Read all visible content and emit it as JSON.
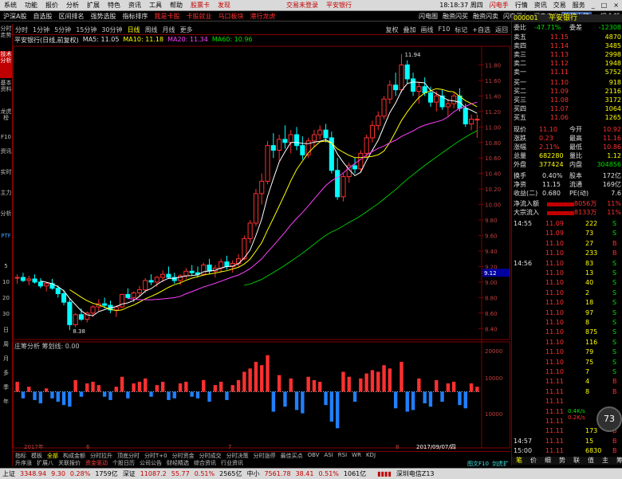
{
  "menubar": {
    "items": [
      "系统",
      "功能",
      "报价",
      "分析",
      "扩展",
      "特色",
      "资讯",
      "工具",
      "帮助"
    ],
    "red_items": [
      "股票卡",
      "发现"
    ],
    "center": [
      "交易未登录",
      "平安银行"
    ],
    "time": "18:18:37 周四",
    "tools": [
      "闪电手",
      "行情",
      "资讯",
      "交易",
      "服务"
    ]
  },
  "navbar": {
    "items": [
      "沪深A股",
      "自选股",
      "区间排名",
      "强势选股",
      "指标排序"
    ],
    "red_items": [
      "我是卡股",
      "卡股就业",
      "乌口板块",
      "港行龙虎"
    ],
    "right": [
      "闪电图",
      "融资闪买",
      "融资闪卖",
      "闪电买入",
      "闪电卖出"
    ],
    "selected": "拖拽上移",
    "extra": "一键全部"
  },
  "chart_toolbar": {
    "periods": [
      "分时",
      "1分钟",
      "5分钟",
      "15分钟",
      "30分钟",
      "日线",
      "周线",
      "月线",
      "更多"
    ],
    "selected": "日线",
    "right": [
      "复权",
      "叠加",
      "画线",
      "F10",
      "标记",
      "+自选",
      "返回"
    ]
  },
  "chart_info": {
    "title": "平安银行(日线,前复权)",
    "ma5": "MA5: 11.05",
    "ma10": "MA10: 11.18",
    "ma20": "MA20: 11.34",
    "ma60": "MA60: 10.96"
  },
  "vol_info": {
    "label": "庄筹分析",
    "sub": "筹划线: 0.00"
  },
  "left_tabs": [
    "分时走势",
    "技术分析",
    "基本资料",
    "龙虎榜",
    "F10",
    "资讯",
    "实时",
    "主力",
    "分析",
    "PTF",
    "5",
    "10",
    "20",
    "30",
    "日",
    "周",
    "月",
    "多",
    "季",
    "年"
  ],
  "price_axis": [
    "11.80",
    "11.60",
    "11.40",
    "11.20",
    "11.00",
    "10.80",
    "10.60",
    "10.40",
    "10.20",
    "10.00",
    "9.80",
    "9.60",
    "9.40",
    "9.20",
    "9.00",
    "8.80",
    "8.60",
    "8.40"
  ],
  "vol_axis": [
    "20000",
    "10000",
    "10000"
  ],
  "price_marks": {
    "high": "11.94",
    "low": "8.38",
    "cursor": "9.12"
  },
  "date_axis": [
    "2017年",
    "6",
    "7",
    "8",
    "2017/09/07/四"
  ],
  "chart_tabs": [
    "指标",
    "模板",
    "全部",
    "构成金额",
    "分时拉升",
    "顶底分时",
    "分时T+0",
    "分时资金",
    "分时成交",
    "分时决策",
    "分时涨停",
    "最佳买点",
    "OBV",
    "ASI",
    "RSI",
    "WR",
    "KDJ"
  ],
  "chart_tabs_sel": "全部",
  "func_tabs": [
    "升序涨",
    "扩展八",
    "关联报价",
    "资金驱动",
    "个股日历",
    "公司公告",
    "财经精选",
    "综合资讯",
    "行业资讯"
  ],
  "func_tabs_red": "资金驱动",
  "quote": {
    "code": "000001",
    "name": "平安银行",
    "wb_label": "委比",
    "wb": "-47.71%",
    "wc_label": "委差",
    "wc": "-12308",
    "asks": [
      {
        "label": "卖五",
        "price": "11.15",
        "vol": "4870"
      },
      {
        "label": "卖四",
        "price": "11.14",
        "vol": "3485"
      },
      {
        "label": "卖三",
        "price": "11.13",
        "vol": "2998"
      },
      {
        "label": "卖二",
        "price": "11.12",
        "vol": "1948"
      },
      {
        "label": "卖一",
        "price": "11.11",
        "vol": "5752"
      }
    ],
    "bids": [
      {
        "label": "买一",
        "price": "11.10",
        "vol": "918"
      },
      {
        "label": "买二",
        "price": "11.09",
        "vol": "2116"
      },
      {
        "label": "买三",
        "price": "11.08",
        "vol": "3172"
      },
      {
        "label": "买四",
        "price": "11.07",
        "vol": "1064"
      },
      {
        "label": "买五",
        "price": "11.06",
        "vol": "1265"
      }
    ],
    "stats": [
      {
        "l1": "现价",
        "v1": "11.10",
        "l2": "今开",
        "v2": "10.92"
      },
      {
        "l1": "涨跌",
        "v1": "0.23",
        "l2": "最高",
        "v2": "11.16"
      },
      {
        "l1": "涨幅",
        "v1": "2.11%",
        "l2": "最低",
        "v2": "10.86"
      },
      {
        "l1": "总量",
        "v1": "682280",
        "l2": "量比",
        "v2": "1.12"
      },
      {
        "l1": "外盘",
        "v1": "377424",
        "l2": "内盘",
        "v2": "304856"
      }
    ],
    "stats2": [
      {
        "l1": "换手",
        "v1": "0.40%",
        "l2": "股本",
        "v2": "172亿"
      },
      {
        "l1": "净资",
        "v1": "11.15",
        "l2": "流通",
        "v2": "169亿"
      },
      {
        "l1": "收益(二)",
        "v1": "0.680",
        "l2": "PE(动)",
        "v2": "7.6"
      }
    ],
    "flows": [
      {
        "label": "净流入额",
        "value": "8056万",
        "pct": "11%"
      },
      {
        "label": "大宗流入",
        "value": "8133万",
        "pct": "11%"
      }
    ],
    "ticks": [
      {
        "t": "14:55",
        "p": "11.09",
        "v": "222",
        "s": "S"
      },
      {
        "t": "",
        "p": "11.09",
        "v": "73",
        "s": "S"
      },
      {
        "t": "",
        "p": "11.10",
        "v": "27",
        "s": "B"
      },
      {
        "t": "",
        "p": "11.10",
        "v": "233",
        "s": "B"
      },
      {
        "t": "14:56",
        "p": "11.10",
        "v": "83",
        "s": "S"
      },
      {
        "t": "",
        "p": "11.10",
        "v": "13",
        "s": "S"
      },
      {
        "t": "",
        "p": "11.10",
        "v": "40",
        "s": "S"
      },
      {
        "t": "",
        "p": "11.10",
        "v": "2",
        "s": "S"
      },
      {
        "t": "",
        "p": "11.10",
        "v": "18",
        "s": "S"
      },
      {
        "t": "",
        "p": "11.10",
        "v": "97",
        "s": "S"
      },
      {
        "t": "",
        "p": "11.10",
        "v": "8",
        "s": "S"
      },
      {
        "t": "",
        "p": "11.10",
        "v": "875",
        "s": "S"
      },
      {
        "t": "",
        "p": "11.10",
        "v": "116",
        "s": "S"
      },
      {
        "t": "",
        "p": "11.10",
        "v": "79",
        "s": "S"
      },
      {
        "t": "",
        "p": "11.10",
        "v": "75",
        "s": "S"
      },
      {
        "t": "",
        "p": "11.10",
        "v": "7",
        "s": "S"
      },
      {
        "t": "",
        "p": "11.11",
        "v": "4",
        "s": "B"
      },
      {
        "t": "",
        "p": "11.11",
        "v": "8",
        "s": "B"
      },
      {
        "t": "",
        "p": "11.11",
        "v": "",
        "s": ""
      },
      {
        "t": "",
        "p": "11.11",
        "v": "",
        "s": ""
      },
      {
        "t": "",
        "p": "11.11",
        "v": "",
        "s": ""
      },
      {
        "t": "",
        "p": "11.11",
        "v": "173",
        "s": "B"
      },
      {
        "t": "14:57",
        "p": "11.11",
        "v": "15",
        "s": "B"
      },
      {
        "t": "15:00",
        "p": "11.11",
        "v": "6830",
        "s": "B"
      }
    ],
    "gauge": "73",
    "gauge_up": "0.4K/s",
    "gauge_dn": "0.2K/s",
    "tail_tabs": [
      "笔",
      "价",
      "细",
      "势",
      "联",
      "值",
      "主",
      "筹"
    ]
  },
  "status": {
    "sh_label": "上证",
    "sh": "3348.94",
    "sh_chg": "9.30",
    "sh_pct": "0.28%",
    "sh_amt": "1759亿",
    "sz_label": "深证",
    "sz": "11087.2",
    "sz_chg": "55.77",
    "sz_pct": "0.51%",
    "sz_amt": "2565亿",
    "zx_label": "中小",
    "zx": "7561.78",
    "zx_chg": "38.41",
    "zx_pct": "0.51%",
    "zx_amt": "1061亿",
    "server": "深圳电信Z13"
  },
  "bottom_right": [
    "图文F10",
    "剑虎扩"
  ],
  "chart_data": {
    "type": "candlestick",
    "ohlc": [
      [
        9.05,
        9.1,
        8.98,
        9.06
      ],
      [
        9.06,
        9.12,
        9.0,
        9.02
      ],
      [
        9.02,
        9.08,
        8.96,
        9.04
      ],
      [
        9.04,
        9.1,
        8.98,
        9.0
      ],
      [
        9.0,
        9.05,
        8.92,
        8.95
      ],
      [
        8.95,
        9.0,
        8.88,
        8.98
      ],
      [
        8.98,
        9.04,
        8.9,
        8.92
      ],
      [
        8.92,
        8.96,
        8.8,
        8.85
      ],
      [
        8.85,
        8.9,
        8.7,
        8.74
      ],
      [
        8.74,
        8.78,
        8.38,
        8.45
      ],
      [
        8.45,
        8.6,
        8.42,
        8.58
      ],
      [
        8.58,
        8.66,
        8.5,
        8.52
      ],
      [
        8.52,
        8.62,
        8.48,
        8.6
      ],
      [
        8.6,
        8.7,
        8.55,
        8.68
      ],
      [
        8.68,
        8.78,
        8.62,
        8.72
      ],
      [
        8.72,
        8.8,
        8.66,
        8.7
      ],
      [
        8.7,
        8.76,
        8.6,
        8.64
      ],
      [
        8.64,
        8.7,
        8.55,
        8.68
      ],
      [
        8.68,
        8.85,
        8.66,
        8.84
      ],
      [
        8.84,
        8.92,
        8.78,
        8.8
      ],
      [
        8.8,
        8.88,
        8.74,
        8.86
      ],
      [
        8.86,
        8.95,
        8.82,
        8.9
      ],
      [
        8.9,
        9.05,
        8.86,
        9.02
      ],
      [
        9.02,
        9.1,
        8.96,
        9.0
      ],
      [
        9.0,
        9.08,
        8.94,
        9.06
      ],
      [
        9.06,
        9.15,
        9.0,
        9.1
      ],
      [
        9.1,
        9.2,
        9.04,
        9.06
      ],
      [
        9.06,
        9.12,
        8.98,
        9.02
      ],
      [
        9.02,
        9.1,
        8.96,
        9.08
      ],
      [
        9.08,
        9.18,
        9.04,
        9.14
      ],
      [
        9.14,
        9.22,
        9.08,
        9.12
      ],
      [
        9.12,
        9.2,
        9.06,
        9.1
      ],
      [
        9.1,
        9.25,
        9.08,
        9.22
      ],
      [
        9.22,
        9.3,
        9.1,
        9.14
      ],
      [
        9.14,
        9.22,
        9.06,
        9.18
      ],
      [
        9.18,
        9.3,
        9.12,
        9.26
      ],
      [
        9.26,
        9.34,
        9.16,
        9.2
      ],
      [
        9.2,
        9.28,
        9.12,
        9.24
      ],
      [
        9.24,
        9.36,
        9.2,
        9.3
      ],
      [
        9.3,
        9.6,
        9.28,
        9.56
      ],
      [
        9.56,
        9.8,
        9.5,
        9.76
      ],
      [
        9.76,
        10.2,
        9.72,
        10.14
      ],
      [
        10.14,
        10.4,
        10.0,
        10.3
      ],
      [
        10.3,
        10.82,
        10.26,
        10.76
      ],
      [
        10.76,
        10.92,
        10.6,
        10.7
      ],
      [
        10.7,
        10.9,
        10.56,
        10.84
      ],
      [
        10.84,
        11.02,
        10.72,
        10.8
      ],
      [
        10.8,
        10.96,
        10.66,
        10.9
      ],
      [
        10.9,
        11.0,
        10.7,
        10.76
      ],
      [
        10.76,
        10.88,
        10.58,
        10.64
      ],
      [
        10.64,
        10.86,
        10.6,
        10.82
      ],
      [
        10.82,
        10.96,
        10.74,
        10.9
      ],
      [
        10.9,
        11.02,
        10.84,
        10.96
      ],
      [
        10.96,
        11.04,
        10.8,
        10.86
      ],
      [
        10.86,
        10.94,
        10.4,
        10.44
      ],
      [
        10.44,
        10.6,
        10.06,
        10.1
      ],
      [
        10.1,
        10.4,
        10.04,
        10.36
      ],
      [
        10.36,
        10.54,
        10.28,
        10.5
      ],
      [
        10.5,
        10.6,
        10.4,
        10.46
      ],
      [
        10.46,
        10.7,
        10.42,
        10.66
      ],
      [
        10.66,
        10.9,
        10.6,
        10.86
      ],
      [
        10.86,
        11.08,
        10.8,
        11.02
      ],
      [
        11.02,
        11.2,
        10.96,
        11.14
      ],
      [
        11.14,
        11.4,
        11.1,
        11.36
      ],
      [
        11.36,
        11.6,
        11.3,
        11.54
      ],
      [
        11.54,
        11.7,
        11.4,
        11.48
      ],
      [
        11.48,
        11.94,
        11.44,
        11.8
      ],
      [
        11.8,
        11.86,
        11.56,
        11.62
      ],
      [
        11.62,
        11.7,
        11.4,
        11.46
      ],
      [
        11.46,
        11.58,
        11.3,
        11.52
      ],
      [
        11.52,
        11.64,
        11.4,
        11.44
      ],
      [
        11.44,
        11.52,
        11.26,
        11.32
      ],
      [
        11.32,
        11.46,
        11.2,
        11.4
      ],
      [
        11.4,
        11.48,
        11.22,
        11.26
      ],
      [
        11.26,
        11.36,
        11.14,
        11.3
      ],
      [
        11.3,
        11.44,
        11.24,
        11.4
      ],
      [
        11.4,
        11.5,
        11.2,
        11.24
      ],
      [
        11.24,
        11.3,
        11.0,
        11.04
      ],
      [
        11.04,
        11.16,
        10.96,
        11.1
      ],
      [
        11.1,
        11.16,
        10.86,
        11.1
      ]
    ],
    "ylim": [
      8.3,
      12.0
    ],
    "volumes": [
      6000,
      -4000,
      3000,
      -5000,
      -7000,
      2000,
      -4000,
      -6000,
      -8000,
      -9000,
      7000,
      -3000,
      5000,
      6000,
      4000,
      -3000,
      -5000,
      3000,
      9000,
      -4000,
      5000,
      6000,
      8000,
      -3000,
      4000,
      6000,
      -5000,
      -4000,
      5000,
      6000,
      -3000,
      -4000,
      7000,
      -6000,
      4000,
      6000,
      -5000,
      4000,
      7000,
      12000,
      14000,
      18000,
      16000,
      22000,
      -12000,
      10000,
      -9000,
      8000,
      -11000,
      -13000,
      9000,
      7000,
      6000,
      -8000,
      -18000,
      -22000,
      12000,
      9000,
      -6000,
      8000,
      11000,
      13000,
      12000,
      16000,
      14000,
      -10000,
      18000,
      -12000,
      -11000,
      8000,
      -7000,
      -9000,
      7000,
      -6000,
      5000,
      6000,
      -8000,
      -10000,
      5000,
      3000
    ],
    "vol_ylim": [
      -30000,
      30000
    ]
  }
}
